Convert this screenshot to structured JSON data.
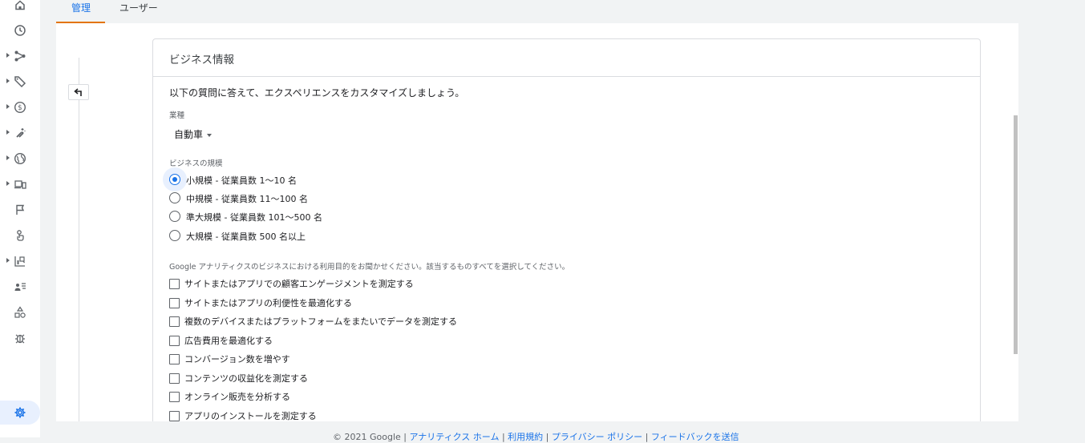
{
  "tabs": [
    {
      "label": "管理",
      "active": true
    },
    {
      "label": "ユーザー",
      "active": false
    }
  ],
  "sidebar": {
    "items": [
      {
        "icon": "home-icon",
        "expandable": false
      },
      {
        "icon": "clock-icon",
        "expandable": false
      },
      {
        "icon": "share-nodes-icon",
        "expandable": true
      },
      {
        "icon": "tag-icon",
        "expandable": true
      },
      {
        "icon": "dollar-icon",
        "expandable": true
      },
      {
        "icon": "magnet-icon",
        "expandable": true
      },
      {
        "icon": "globe-icon",
        "expandable": true
      },
      {
        "icon": "devices-icon",
        "expandable": true
      },
      {
        "icon": "flag-icon",
        "expandable": false
      },
      {
        "icon": "touch-icon",
        "expandable": false
      },
      {
        "icon": "report-icon",
        "expandable": true
      },
      {
        "icon": "audience-icon",
        "expandable": false
      },
      {
        "icon": "shapes-icon",
        "expandable": false
      },
      {
        "icon": "debug-icon",
        "expandable": false
      }
    ],
    "settings_icon": "settings-gear-icon"
  },
  "card": {
    "title": "ビジネス情報",
    "intro": "以下の質問に答えて、エクスペリエンスをカスタマイズしましょう。",
    "industry_label": "業種",
    "industry_value": "自動車",
    "size_label": "ビジネスの規模",
    "sizes": [
      {
        "label": "小規模 - 従業員数 1～10 名",
        "checked": true
      },
      {
        "label": "中規模 - 従業員数 11～100 名",
        "checked": false
      },
      {
        "label": "準大規模 - 従業員数 101～500 名",
        "checked": false
      },
      {
        "label": "大規模 - 従業員数 500 名以上",
        "checked": false
      }
    ],
    "purpose_label": "Google アナリティクスのビジネスにおける利用目的をお聞かせください。該当するものすべてを選択してください。",
    "purposes": [
      {
        "label": "サイトまたはアプリでの顧客エンゲージメントを測定する",
        "checked": false
      },
      {
        "label": "サイトまたはアプリの利便性を最適化する",
        "checked": false
      },
      {
        "label": "複数のデバイスまたはプラットフォームをまたいでデータを測定する",
        "checked": false
      },
      {
        "label": "広告費用を最適化する",
        "checked": false
      },
      {
        "label": "コンバージョン数を増やす",
        "checked": false
      },
      {
        "label": "コンテンツの収益化を測定する",
        "checked": false
      },
      {
        "label": "オンライン販売を分析する",
        "checked": false
      },
      {
        "label": "アプリのインストールを測定する",
        "checked": false
      }
    ]
  },
  "footer": {
    "copyright": "© 2021 Google",
    "sep": " | ",
    "links": [
      "アナリティクス ホーム",
      "利用規約",
      "プライバシー ポリシー",
      "フィードバックを送信"
    ]
  },
  "colors": {
    "accent": "#1a73e8",
    "tab_underline": "#e37400",
    "selected_bg": "#e8f0fe"
  }
}
